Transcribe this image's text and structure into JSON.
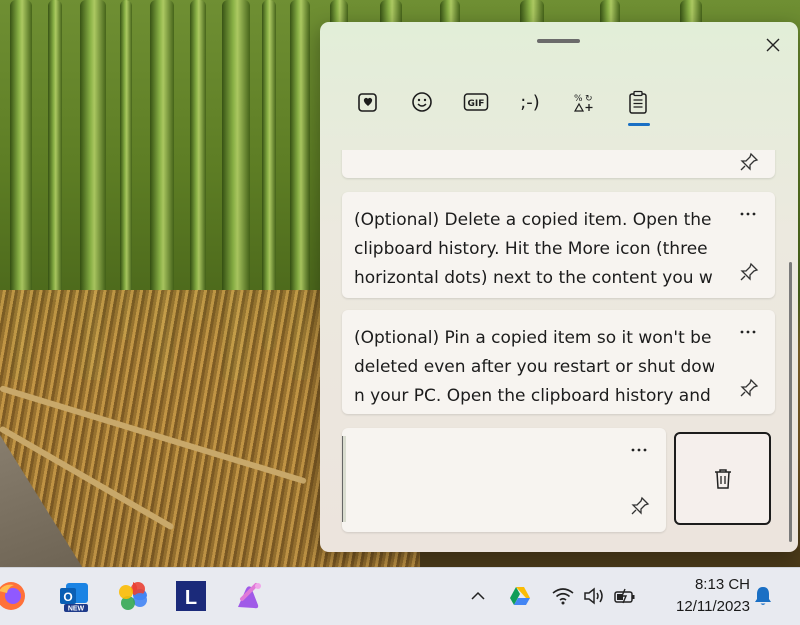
{
  "panel": {
    "close_label": "×",
    "tabs": [
      {
        "name": "tab-recently-used",
        "icon": "heart-box-icon"
      },
      {
        "name": "tab-emoji",
        "icon": "smiley-icon"
      },
      {
        "name": "tab-gif",
        "icon": "gif-icon",
        "label": "GIF"
      },
      {
        "name": "tab-kaomoji",
        "icon": "kaomoji-icon",
        "label": ";-)"
      },
      {
        "name": "tab-symbols",
        "icon": "symbols-icon"
      },
      {
        "name": "tab-clipboard",
        "icon": "clipboard-icon",
        "active": true
      }
    ],
    "accent": "#1a6fc4",
    "clipboard_items": [
      {
        "lines": [
          "(Optional) Delete a copied item. Open the",
          "clipboard history. Hit the More icon (three",
          "horizontal dots) next to the content you w"
        ]
      },
      {
        "lines": [
          "(Optional) Pin a copied item so it won't be",
          "deleted even after you restart or shut dow",
          "n your PC. Open the clipboard history and"
        ]
      }
    ],
    "more_label": "···"
  },
  "taskbar": {
    "apps": [
      "firefox-icon",
      "outlook-new-icon",
      "google-photos-icon",
      "l-app-icon",
      "copilot-icon"
    ],
    "outlook_badge": "NEW",
    "l_app_letter": "L",
    "tray": [
      "chevron-up-icon",
      "google-drive-icon",
      "wifi-icon",
      "volume-icon",
      "battery-icon",
      "notification-bell-icon"
    ],
    "time": "8:13 CH",
    "date": "12/11/2023"
  }
}
